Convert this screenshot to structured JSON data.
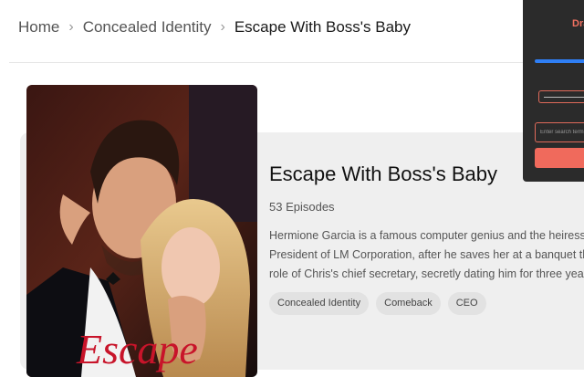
{
  "breadcrumb": {
    "items": [
      "Home",
      "Concealed Identity",
      "Escape With Boss's Baby"
    ],
    "separator": "›"
  },
  "drama": {
    "title": "Escape With Boss's Baby",
    "episodes": "53 Episodes",
    "description_lines": [
      "Hermione Garcia is a famous computer genius and the heiress to",
      "President of LM Corporation, after he saves her at a banquet thre",
      "role of Chris's chief secretary, secretly dating him for three years."
    ],
    "tags": [
      "Concealed Identity",
      "Comeback",
      "CEO"
    ],
    "cover_text": "Escape"
  },
  "panel": {
    "title": "Dra",
    "search_placeholder": "Enter search term"
  },
  "colors": {
    "accent": "#f06a5c",
    "progress": "#2f7ff5",
    "panel_bg": "#2b2b2b"
  }
}
